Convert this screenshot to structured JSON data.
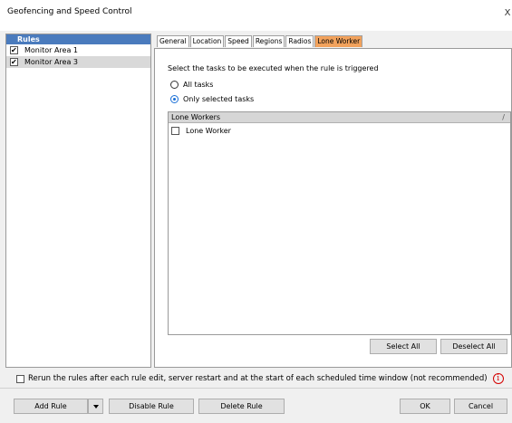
{
  "window": {
    "title": "Geofencing and Speed Control",
    "close_glyph": "X"
  },
  "rules": {
    "header": "Rules",
    "items": [
      {
        "label": "Monitor Area 1",
        "checked": true,
        "selected": false
      },
      {
        "label": "Monitor Area 3",
        "checked": true,
        "selected": true
      }
    ]
  },
  "tabs": [
    "General",
    "Location",
    "Speed",
    "Regions",
    "Radios",
    "Lone Worker"
  ],
  "active_tab": "Lone Worker",
  "lone_worker": {
    "description": "Select the tasks to be executed when the rule is triggered",
    "option_all": "All tasks",
    "option_selected": "Only selected tasks",
    "selected_option": "Only selected tasks",
    "list_header": "Lone Workers",
    "sort_mark": "/",
    "items": [
      {
        "label": "Lone Worker",
        "checked": false
      }
    ],
    "select_all": "Select All",
    "deselect_all": "Deselect All"
  },
  "rerun": {
    "label": "Rerun the rules after each rule edit, server restart and at the start of each scheduled time window (not recommended)",
    "checked": false,
    "info_glyph": "i"
  },
  "footer": {
    "add_rule": "Add Rule",
    "disable_rule": "Disable Rule",
    "delete_rule": "Delete Rule",
    "ok": "OK",
    "cancel": "Cancel"
  },
  "colors": {
    "rules_header_bg": "#4a7bbd",
    "active_tab_bg": "#f2a25c",
    "radio_accent": "#1a6fd6",
    "warning_red": "#d40000"
  }
}
